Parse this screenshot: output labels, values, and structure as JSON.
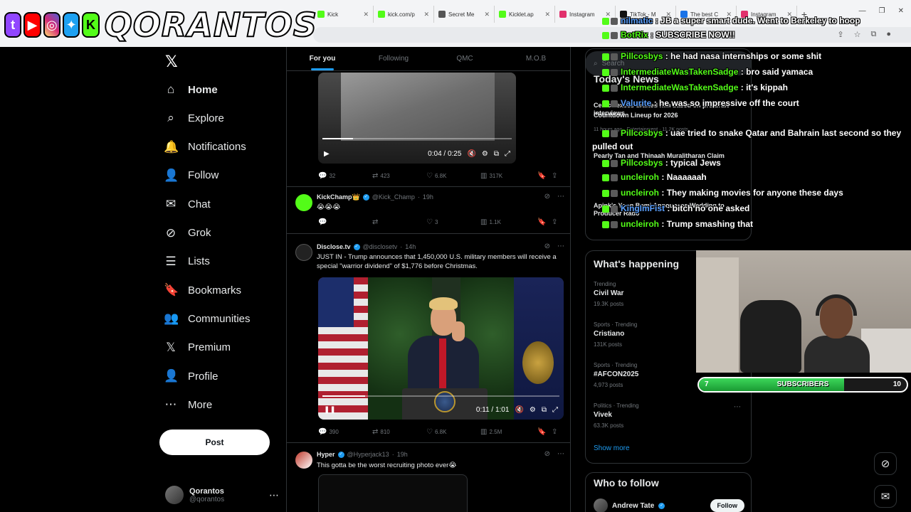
{
  "overlay": {
    "brand_text": "QORANTOS",
    "platform_icons": [
      "twitch-icon",
      "youtube-icon",
      "instagram-icon",
      "twitter-icon",
      "kick-icon"
    ]
  },
  "browser": {
    "tabs": [
      {
        "label": "Kick",
        "color": "#53fc18"
      },
      {
        "label": "kick.com/p",
        "color": "#53fc18"
      },
      {
        "label": "Secret Me",
        "color": "#555555"
      },
      {
        "label": "Kicklet.ap",
        "color": "#53fc18"
      },
      {
        "label": "Instagram",
        "color": "#e1306c"
      },
      {
        "label": "TikTok - M",
        "color": "#111111"
      },
      {
        "label": "The best C",
        "color": "#1a73e8"
      },
      {
        "label": "Instagram",
        "color": "#e1306c"
      }
    ]
  },
  "sidebar": {
    "items": [
      {
        "label": "Home",
        "icon": "home-icon",
        "glyph": "⌂"
      },
      {
        "label": "Explore",
        "icon": "search-icon",
        "glyph": "⌕"
      },
      {
        "label": "Notifications",
        "icon": "bell-icon",
        "glyph": "🔔"
      },
      {
        "label": "Follow",
        "icon": "follow-icon",
        "glyph": "👤"
      },
      {
        "label": "Chat",
        "icon": "mail-icon",
        "glyph": "✉"
      },
      {
        "label": "Grok",
        "icon": "grok-icon",
        "glyph": "⊘"
      },
      {
        "label": "Lists",
        "icon": "list-icon",
        "glyph": "☰"
      },
      {
        "label": "Bookmarks",
        "icon": "bookmark-icon",
        "glyph": "🔖"
      },
      {
        "label": "Communities",
        "icon": "communities-icon",
        "glyph": "👥"
      },
      {
        "label": "Premium",
        "icon": "x-premium-icon",
        "glyph": "𝕏"
      },
      {
        "label": "Profile",
        "icon": "profile-icon",
        "glyph": "👤"
      },
      {
        "label": "More",
        "icon": "more-icon",
        "glyph": "⋯"
      }
    ],
    "post_label": "Post",
    "account": {
      "name": "Qorantos",
      "handle": "@qorantos"
    }
  },
  "feed": {
    "tabs": [
      "For you",
      "Following",
      "QMC",
      "M.O.B"
    ],
    "video1": {
      "time": "0:04 / 0:25",
      "progress": 0.16
    },
    "video1_actions": {
      "replies": "32",
      "reposts": "423",
      "likes": "6.8K",
      "views": "317K"
    },
    "tweets": [
      {
        "name": "KickChamp👑",
        "handle": "@Kick_Champ",
        "time": "19h",
        "text": "😭😭😭",
        "actions": {
          "replies": "",
          "reposts": "",
          "likes": "3",
          "views": "1.1K"
        }
      },
      {
        "name": "Disclose.tv",
        "handle": "@disclosetv",
        "time": "14h",
        "text": "JUST IN - Trump announces that 1,450,000 U.S. military members will receive a special \"warrior dividend\" of $1,776 before Christmas.",
        "video_time": "0:11 / 1:01",
        "video_progress": 0.18,
        "actions": {
          "replies": "390",
          "reposts": "810",
          "likes": "6.8K",
          "views": "2.5M"
        }
      },
      {
        "name": "Hyper",
        "handle": "@Hyperjack13",
        "time": "19h",
        "text": "This gotta be the worst recruiting photo ever😭"
      }
    ]
  },
  "right": {
    "search_placeholder": "Search",
    "news_title": "Today's News",
    "news": [
      {
        "title": "Celtics execs drafted him based on pre-draft interviews",
        "meta": ""
      },
      {
        "title": "Countdown Lineup for 2026",
        "meta": "11 hours ago · Entertainment · 11.2K posts"
      },
      {
        "title": "Pearly Tan and Thinaah Muralitharan Claim",
        "meta": ""
      },
      {
        "title": "Apink's Yoon Bomi Announces Wedding to Producer Rado",
        "meta": ""
      }
    ],
    "happening_title": "What's happening",
    "trends": [
      {
        "category": "Trending",
        "name": "Civil War",
        "count": "19.3K posts"
      },
      {
        "category": "Sports · Trending",
        "name": "Cristiano",
        "count": "131K posts"
      },
      {
        "category": "Sports · Trending",
        "name": "#AFCON2025",
        "count": "4,973 posts"
      },
      {
        "category": "Politics · Trending",
        "name": "Vivek",
        "count": "63.3K posts"
      }
    ],
    "show_more": "Show more",
    "who_title": "Who to follow",
    "follow_suggestion": {
      "name": "Andrew Tate",
      "button": "Follow"
    }
  },
  "chat": {
    "messages": [
      {
        "user": "nilmatic",
        "color": "#5aa0ff",
        "text": "JB a super smart dude. Went to Berkeley to hoop"
      },
      {
        "user": "BotRix",
        "color": "#53fc18",
        "text": "SUBSCRIBE NOW!!"
      },
      {
        "user": "Pillcosbys",
        "color": "#53fc18",
        "text": "he had nasa internships or some shit"
      },
      {
        "user": "IntermediateWasTakenSadge",
        "color": "#53fc18",
        "text": "bro said yamaca"
      },
      {
        "user": "IntermediateWasTakenSadge",
        "color": "#53fc18",
        "text": "it's kippah"
      },
      {
        "user": "Valurite",
        "color": "#5aa0ff",
        "text": "he was so impressive off the court"
      },
      {
        "user": "Pillcosbys",
        "color": "#53fc18",
        "text": "uae tried to snake Qatar and Bahrain last second so they pulled out"
      },
      {
        "user": "Pillcosbys",
        "color": "#53fc18",
        "text": "typical Jews"
      },
      {
        "user": "uncleiroh",
        "color": "#53fc18",
        "text": "Naaaaaah"
      },
      {
        "user": "uncleiroh",
        "color": "#53fc18",
        "text": "They making movies for anyone these days"
      },
      {
        "user": "KingImFist",
        "color": "#5aa0ff",
        "text": "bitch no one asked"
      },
      {
        "user": "uncleiroh",
        "color": "#53fc18",
        "text": "Trump smashing that"
      }
    ]
  },
  "subs_goal": {
    "label": "SUBSCRIBERS",
    "current": "7",
    "goal": "10",
    "progress": 0.7
  }
}
